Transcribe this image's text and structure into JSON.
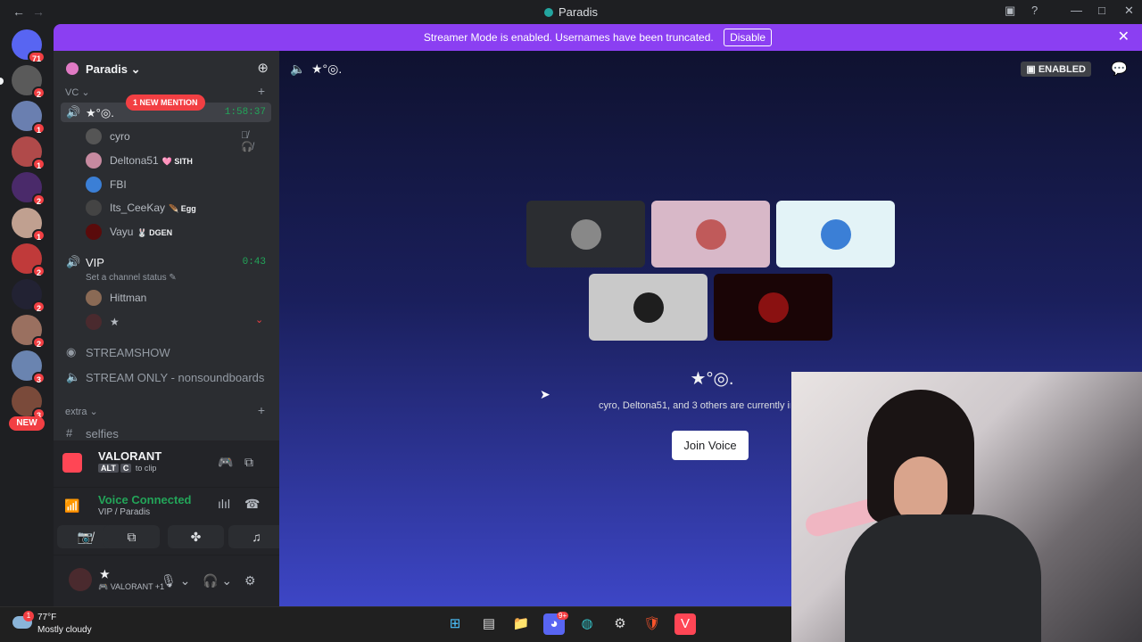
{
  "window": {
    "title": "Paradis"
  },
  "banner": {
    "text": "Streamer Mode is enabled. Usernames have been truncated.",
    "disable_label": "Disable"
  },
  "rail": {
    "discord_badge": "71",
    "servers": [
      {
        "badge": "2",
        "color": "#5a5a5a"
      },
      {
        "badge": "1",
        "color": "#6a7fb0"
      },
      {
        "badge": "1",
        "color": "#b04a4a"
      },
      {
        "badge": "2",
        "color": "#4a2a6a"
      },
      {
        "badge": "1",
        "color": "#c0a090"
      },
      {
        "badge": "2",
        "color": "#c03a3a"
      },
      {
        "badge": "2",
        "color": "#222233"
      },
      {
        "badge": "2",
        "color": "#9a7060"
      },
      {
        "badge": "3",
        "color": "#6a84b0"
      },
      {
        "badge": "3",
        "color": "#7a4a3a"
      }
    ],
    "new_label": "NEW"
  },
  "server": {
    "name": "Paradis"
  },
  "channels": {
    "cat_vc": "VC",
    "active_channel": {
      "name": "★°◎.",
      "timer": "1:58:37",
      "mention": "1 NEW MENTION"
    },
    "members": [
      {
        "name": "cyro",
        "tag": "",
        "color": "#555"
      },
      {
        "name": "Deltona51",
        "tag": "🩷 SITH",
        "color": "#c78aa0"
      },
      {
        "name": "FBI",
        "tag": "",
        "color": "#3b7fd6"
      },
      {
        "name": "Its_CeeKay",
        "tag": "🪶 Egg",
        "color": "#444"
      },
      {
        "name": "Vayu",
        "tag": "🐰 DGEN",
        "color": "#5a0b0b"
      }
    ],
    "vip": {
      "name": "VIP",
      "timer": "0:43",
      "status": "Set a channel status"
    },
    "vip_members": [
      {
        "name": "Hittman",
        "color": "#8a6a55"
      },
      {
        "name": "★",
        "color": "#4a2a2e"
      }
    ],
    "streamshow": "STREAMSHOW",
    "stream_only": "STREAM ONLY - nonsoundboards",
    "cat_extra": "extra",
    "selfies": "selfies"
  },
  "activity": {
    "game": "VALORANT",
    "key1": "ALT",
    "key2": "C",
    "hint": "to clip"
  },
  "voice": {
    "status": "Voice Connected",
    "location": "VIP / Paradis"
  },
  "user": {
    "name": "★",
    "status": "VALORANT +1"
  },
  "stage": {
    "channel_name": "★°◎.",
    "enabled": "ENABLED",
    "present_text": "cyro, Deltona51, and 3 others are currently in voice",
    "join_label": "Join Voice",
    "tiles": [
      {
        "bg": "#2b2d31",
        "av": "#888"
      },
      {
        "bg": "#d8b8c8",
        "av": "#c05a5a"
      },
      {
        "bg": "#e3f3f7",
        "av": "#3b7fd6"
      },
      {
        "bg": "#c9c9c9",
        "av": "#1e1e1e"
      },
      {
        "bg": "#1a0506",
        "av": "#8a1111"
      }
    ]
  },
  "weather": {
    "temp": "77°F",
    "desc": "Mostly cloudy",
    "badge": "1"
  },
  "taskbar": {
    "discord_badge": "9+"
  }
}
